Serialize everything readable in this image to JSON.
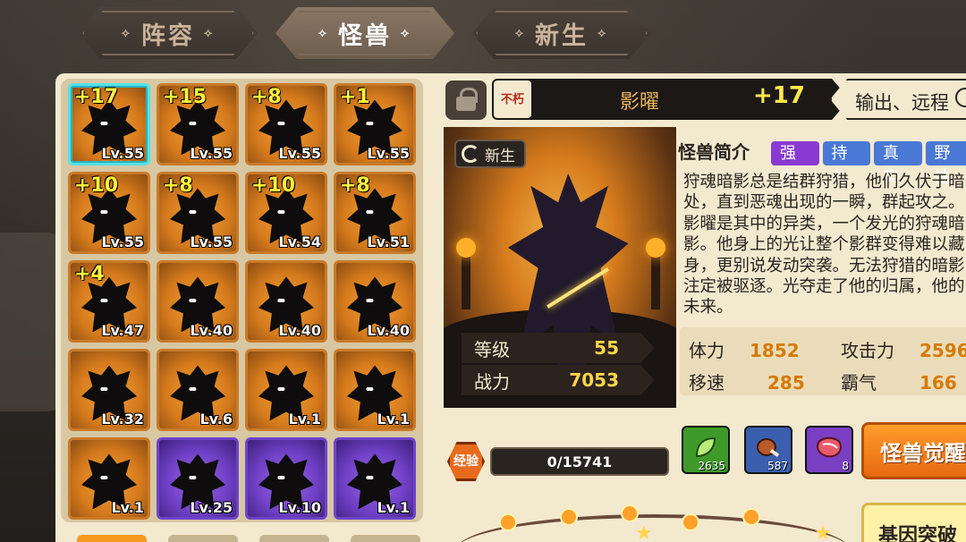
{
  "tabs": [
    {
      "label": "阵容",
      "active": false
    },
    {
      "label": "怪兽",
      "active": true
    },
    {
      "label": "新生",
      "active": false
    }
  ],
  "tab_decoration": "⟡",
  "roster": [
    {
      "plus": "+17",
      "level": "Lv.55",
      "rarity": "orange",
      "selected": true
    },
    {
      "plus": "+15",
      "level": "Lv.55",
      "rarity": "orange"
    },
    {
      "plus": "+8",
      "level": "Lv.55",
      "rarity": "orange"
    },
    {
      "plus": "+1",
      "level": "Lv.55",
      "rarity": "orange"
    },
    {
      "plus": "+10",
      "level": "Lv.55",
      "rarity": "orange"
    },
    {
      "plus": "+8",
      "level": "Lv.55",
      "rarity": "orange"
    },
    {
      "plus": "+10",
      "level": "Lv.54",
      "rarity": "orange"
    },
    {
      "plus": "+8",
      "level": "Lv.51",
      "rarity": "orange"
    },
    {
      "plus": "+4",
      "level": "Lv.47",
      "rarity": "orange"
    },
    {
      "plus": "",
      "level": "Lv.40",
      "rarity": "orange"
    },
    {
      "plus": "",
      "level": "Lv.40",
      "rarity": "orange"
    },
    {
      "plus": "",
      "level": "Lv.40",
      "rarity": "orange"
    },
    {
      "plus": "",
      "level": "Lv.32",
      "rarity": "orange"
    },
    {
      "plus": "",
      "level": "Lv.6",
      "rarity": "orange"
    },
    {
      "plus": "",
      "level": "Lv.1",
      "rarity": "orange"
    },
    {
      "plus": "",
      "level": "Lv.1",
      "rarity": "orange"
    },
    {
      "plus": "",
      "level": "Lv.1",
      "rarity": "orange"
    },
    {
      "plus": "",
      "level": "Lv.25",
      "rarity": "purple"
    },
    {
      "plus": "",
      "level": "Lv.10",
      "rarity": "purple"
    },
    {
      "plus": "",
      "level": "Lv.1",
      "rarity": "purple"
    }
  ],
  "detail": {
    "badge": "不朽",
    "name": "影曜",
    "plus": "+17",
    "role": "输出、远程",
    "reborn_tag": "新生",
    "stats": [
      {
        "label": "等级",
        "value": "55"
      },
      {
        "label": "战力",
        "value": "7053"
      }
    ],
    "intro_title": "怪兽简介",
    "traits": [
      "强力",
      "持久",
      "真实",
      "野性"
    ],
    "description": "狩魂暗影总是结群狩猎，他们久伏于暗处，直到恶魂出现的一瞬，群起攻之。影曜是其中的异类，一个发光的狩魂暗影。他身上的光让整个影群变得难以藏身，更别说发动突袭。无法狩猎的暗影注定被驱逐。光夺走了他的归属，他的未来。",
    "attributes": [
      {
        "label": "体力",
        "value": "1852"
      },
      {
        "label": "攻击力",
        "value": "2596"
      },
      {
        "label": "移速",
        "value": "285"
      },
      {
        "label": "霸气",
        "value": "166"
      }
    ]
  },
  "experience": {
    "label": "经验",
    "value": "0/15741"
  },
  "items": [
    {
      "icon": "leaf-icon",
      "count": "2635",
      "color": "#3f9a2a"
    },
    {
      "icon": "meat-icon",
      "count": "587",
      "color": "#3a5fae"
    },
    {
      "icon": "steak-icon",
      "count": "8",
      "color": "#7a3fc2"
    }
  ],
  "buttons": {
    "awaken": "怪兽觉醒",
    "gene": "基因突破"
  },
  "colors": {
    "panel": "#f3e9cf",
    "orange_card": "#d57a1c",
    "purple_card": "#6e3fc4",
    "accent_yellow": "#ffd54a"
  }
}
